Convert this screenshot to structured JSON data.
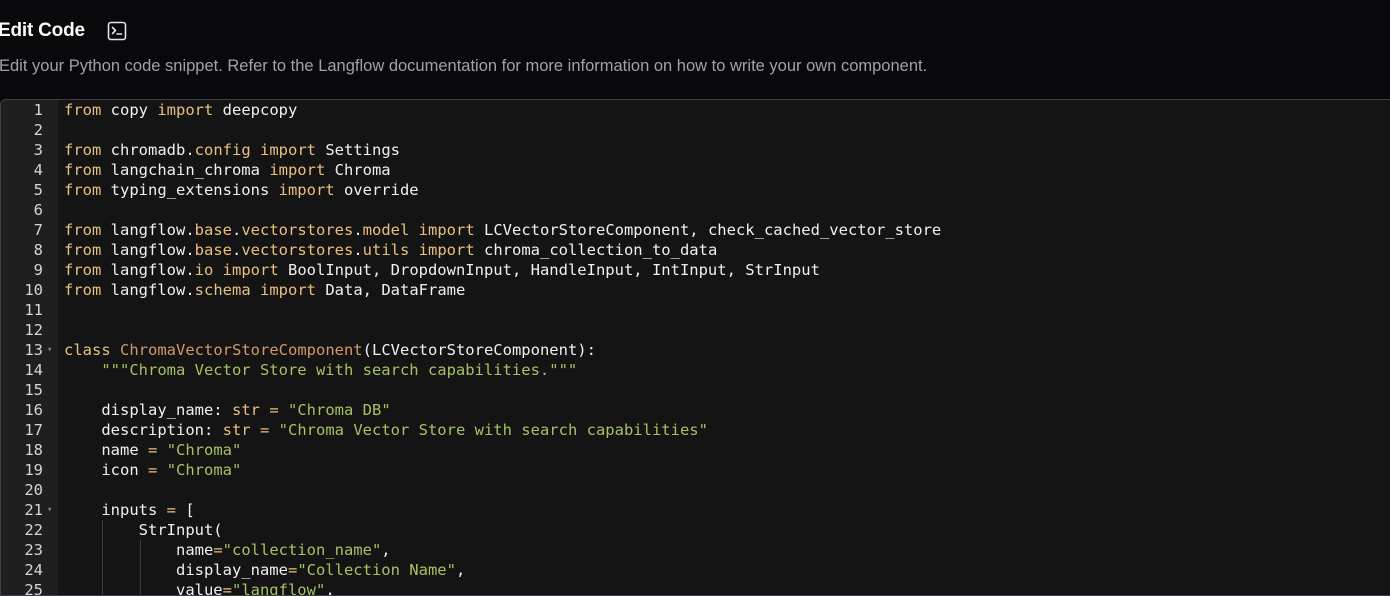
{
  "header": {
    "title": "Edit Code",
    "icon": "terminal-square-icon",
    "description": "Edit your Python code snippet. Refer to the Langflow documentation for more information on how to write your own component."
  },
  "editor": {
    "language": "python",
    "lines": [
      {
        "n": "1",
        "tokens": [
          [
            "kw",
            "from"
          ],
          [
            "plain",
            " copy "
          ],
          [
            "kw",
            "import"
          ],
          [
            "plain",
            " deepcopy"
          ]
        ]
      },
      {
        "n": "2",
        "tokens": []
      },
      {
        "n": "3",
        "tokens": [
          [
            "kw",
            "from"
          ],
          [
            "plain",
            " chromadb."
          ],
          [
            "mod",
            "config"
          ],
          [
            "plain",
            " "
          ],
          [
            "kw",
            "import"
          ],
          [
            "plain",
            " Settings"
          ]
        ]
      },
      {
        "n": "4",
        "tokens": [
          [
            "kw",
            "from"
          ],
          [
            "plain",
            " langchain_chroma "
          ],
          [
            "kw",
            "import"
          ],
          [
            "plain",
            " Chroma"
          ]
        ]
      },
      {
        "n": "5",
        "tokens": [
          [
            "kw",
            "from"
          ],
          [
            "plain",
            " typing_extensions "
          ],
          [
            "kw",
            "import"
          ],
          [
            "plain",
            " override"
          ]
        ]
      },
      {
        "n": "6",
        "tokens": []
      },
      {
        "n": "7",
        "tokens": [
          [
            "kw",
            "from"
          ],
          [
            "plain",
            " langflow."
          ],
          [
            "mod",
            "base"
          ],
          [
            "plain",
            "."
          ],
          [
            "mod",
            "vectorstores"
          ],
          [
            "plain",
            "."
          ],
          [
            "mod",
            "model"
          ],
          [
            "plain",
            " "
          ],
          [
            "kw",
            "import"
          ],
          [
            "plain",
            " LCVectorStoreComponent, check_cached_vector_store"
          ]
        ]
      },
      {
        "n": "8",
        "tokens": [
          [
            "kw",
            "from"
          ],
          [
            "plain",
            " langflow."
          ],
          [
            "mod",
            "base"
          ],
          [
            "plain",
            "."
          ],
          [
            "mod",
            "vectorstores"
          ],
          [
            "plain",
            "."
          ],
          [
            "mod",
            "utils"
          ],
          [
            "plain",
            " "
          ],
          [
            "kw",
            "import"
          ],
          [
            "plain",
            " chroma_collection_to_data"
          ]
        ]
      },
      {
        "n": "9",
        "tokens": [
          [
            "kw",
            "from"
          ],
          [
            "plain",
            " langflow."
          ],
          [
            "mod",
            "io"
          ],
          [
            "plain",
            " "
          ],
          [
            "kw",
            "import"
          ],
          [
            "plain",
            " BoolInput, DropdownInput, HandleInput, IntInput, StrInput"
          ]
        ]
      },
      {
        "n": "10",
        "tokens": [
          [
            "kw",
            "from"
          ],
          [
            "plain",
            " langflow."
          ],
          [
            "mod",
            "schema"
          ],
          [
            "plain",
            " "
          ],
          [
            "kw",
            "import"
          ],
          [
            "plain",
            " Data, DataFrame"
          ]
        ]
      },
      {
        "n": "11",
        "tokens": []
      },
      {
        "n": "12",
        "tokens": []
      },
      {
        "n": "13",
        "fold": true,
        "tokens": [
          [
            "kw",
            "class"
          ],
          [
            "plain",
            " "
          ],
          [
            "cls",
            "ChromaVectorStoreComponent"
          ],
          [
            "plain",
            "(LCVectorStoreComponent):"
          ]
        ]
      },
      {
        "n": "14",
        "tokens": [
          [
            "plain",
            "    "
          ],
          [
            "str",
            "\"\"\"Chroma Vector Store with search capabilities.\"\"\""
          ]
        ]
      },
      {
        "n": "15",
        "tokens": []
      },
      {
        "n": "16",
        "tokens": [
          [
            "plain",
            "    display_name: "
          ],
          [
            "kw",
            "str"
          ],
          [
            "plain",
            " "
          ],
          [
            "op",
            "="
          ],
          [
            "plain",
            " "
          ],
          [
            "str",
            "\"Chroma DB\""
          ]
        ]
      },
      {
        "n": "17",
        "tokens": [
          [
            "plain",
            "    description: "
          ],
          [
            "kw",
            "str"
          ],
          [
            "plain",
            " "
          ],
          [
            "op",
            "="
          ],
          [
            "plain",
            " "
          ],
          [
            "str",
            "\"Chroma Vector Store with search capabilities\""
          ]
        ]
      },
      {
        "n": "18",
        "tokens": [
          [
            "plain",
            "    name "
          ],
          [
            "op",
            "="
          ],
          [
            "plain",
            " "
          ],
          [
            "str",
            "\"Chroma\""
          ]
        ]
      },
      {
        "n": "19",
        "tokens": [
          [
            "plain",
            "    icon "
          ],
          [
            "op",
            "="
          ],
          [
            "plain",
            " "
          ],
          [
            "str",
            "\"Chroma\""
          ]
        ]
      },
      {
        "n": "20",
        "tokens": []
      },
      {
        "n": "21",
        "fold": true,
        "tokens": [
          [
            "plain",
            "    inputs "
          ],
          [
            "op",
            "="
          ],
          [
            "plain",
            " ["
          ]
        ]
      },
      {
        "n": "22",
        "tokens": [
          [
            "plain",
            "        StrInput("
          ]
        ]
      },
      {
        "n": "23",
        "tokens": [
          [
            "plain",
            "            name"
          ],
          [
            "op",
            "="
          ],
          [
            "str",
            "\"collection_name\""
          ],
          [
            "plain",
            ","
          ]
        ]
      },
      {
        "n": "24",
        "tokens": [
          [
            "plain",
            "            display_name"
          ],
          [
            "op",
            "="
          ],
          [
            "str",
            "\"Collection Name\""
          ],
          [
            "plain",
            ","
          ]
        ]
      },
      {
        "n": "25",
        "tokens": [
          [
            "plain",
            "            value"
          ],
          [
            "op",
            "="
          ],
          [
            "str",
            "\"langflow\""
          ],
          [
            "plain",
            ","
          ]
        ]
      }
    ]
  }
}
